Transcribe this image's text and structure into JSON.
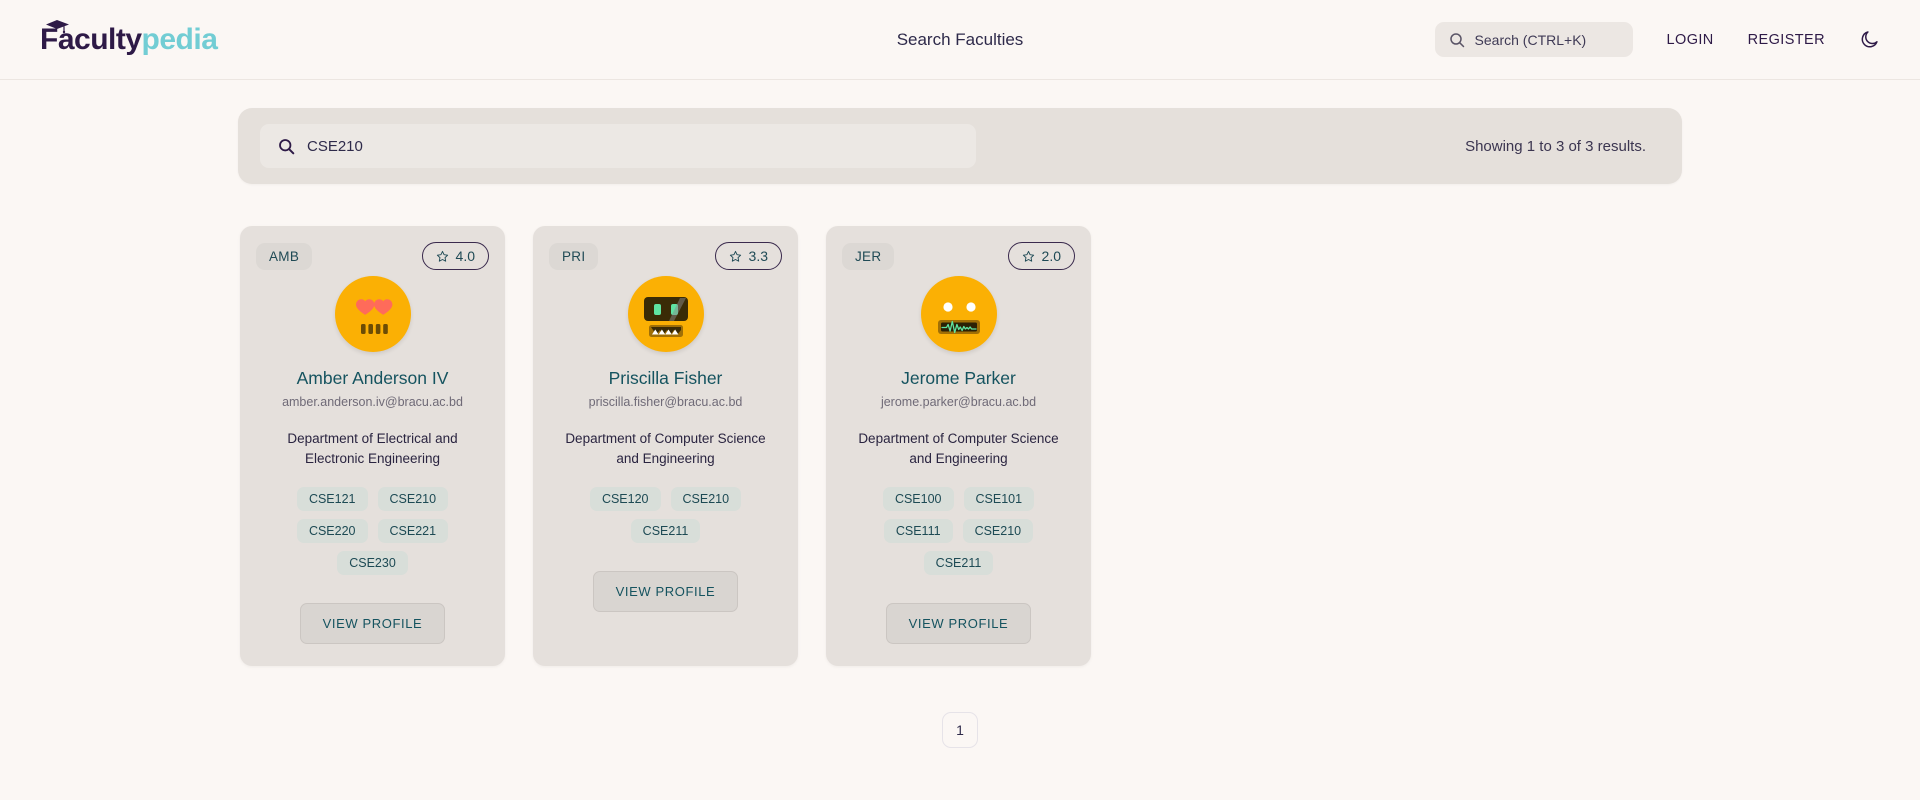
{
  "header": {
    "logo_primary": "Faculty",
    "logo_secondary": "pedia",
    "center_title": "Search Faculties",
    "search_placeholder": "Search (CTRL+K)",
    "login_label": "LOGIN",
    "register_label": "REGISTER",
    "theme_icon": "moon-icon"
  },
  "search": {
    "icon": "search-icon",
    "value": "CSE210",
    "placeholder": "Search",
    "results_text": "Showing 1 to 3 of 3 results."
  },
  "cards": [
    {
      "initials": "AMB",
      "rating": "4.0",
      "rating_icon": "star-icon",
      "avatar": "heart-eyes-grill-face",
      "name": "Amber Anderson IV",
      "email": "amber.anderson.iv@bracu.ac.bd",
      "department": "Department of Electrical and Electronic Engineering",
      "courses": [
        "CSE121",
        "CSE210",
        "CSE220",
        "CSE221",
        "CSE230"
      ],
      "button_label": "VIEW PROFILE"
    },
    {
      "initials": "PRI",
      "rating": "3.3",
      "rating_icon": "star-icon",
      "avatar": "visor-teeth-robot-face",
      "name": "Priscilla Fisher",
      "email": "priscilla.fisher@bracu.ac.bd",
      "department": "Department of Computer Science and Engineering",
      "courses": [
        "CSE120",
        "CSE210",
        "CSE211"
      ],
      "button_label": "VIEW PROFILE"
    },
    {
      "initials": "JER",
      "rating": "2.0",
      "rating_icon": "star-icon",
      "avatar": "dot-eyes-waveform-face",
      "name": "Jerome Parker",
      "email": "jerome.parker@bracu.ac.bd",
      "department": "Department of Computer Science and Engineering",
      "courses": [
        "CSE100",
        "CSE101",
        "CSE111",
        "CSE210",
        "CSE211"
      ],
      "button_label": "VIEW PROFILE"
    }
  ],
  "pagination": {
    "current_page": "1"
  },
  "colors": {
    "page_bg": "#fbf7f4",
    "card_bg": "#e5e0dc",
    "logo_primary": "#2e1a47",
    "logo_secondary": "#72cdd4",
    "accent_teal": "#15535f",
    "avatar_bg": "#fbb004"
  }
}
